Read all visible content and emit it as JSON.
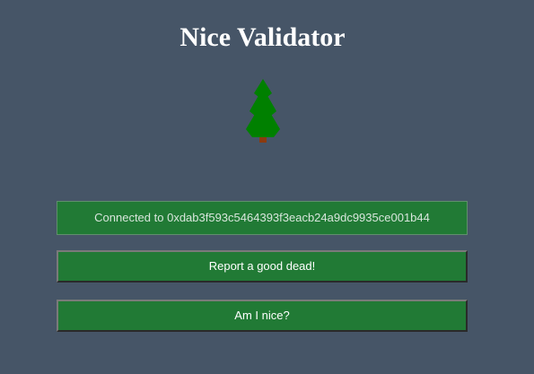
{
  "app": {
    "title": "Nice Validator"
  },
  "status": {
    "text": "Connected to 0xdab3f593c5464393f3eacb24a9dc9935ce001b44"
  },
  "buttons": {
    "report_label": "Report a good dead!",
    "nice_label": "Am I nice?"
  },
  "icons": {
    "logo": "christmas-tree-icon"
  },
  "colors": {
    "background": "#465567",
    "button": "#217a35",
    "tree": "#008000",
    "trunk": "#8b3a0f"
  }
}
